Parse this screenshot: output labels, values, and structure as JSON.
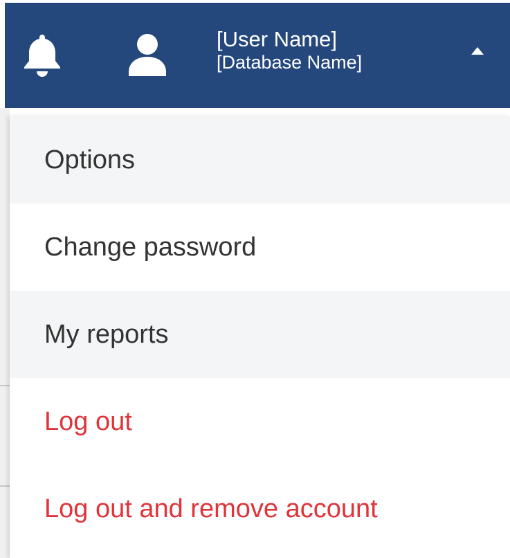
{
  "header": {
    "notifications_icon": "bell-icon",
    "user_icon": "user-icon",
    "user_name": "[User Name]",
    "database_name": "[Database Name]",
    "dropdown_toggle_icon": "caret-up-icon",
    "background_color": "#24477c"
  },
  "menu": {
    "items": [
      {
        "label": "Options",
        "variant": "default"
      },
      {
        "label": "Change password",
        "variant": "default"
      },
      {
        "label": "My reports",
        "variant": "default"
      },
      {
        "label": "Log out",
        "variant": "danger"
      },
      {
        "label": "Log out and remove account",
        "variant": "danger"
      }
    ],
    "danger_color": "#e0333a"
  }
}
